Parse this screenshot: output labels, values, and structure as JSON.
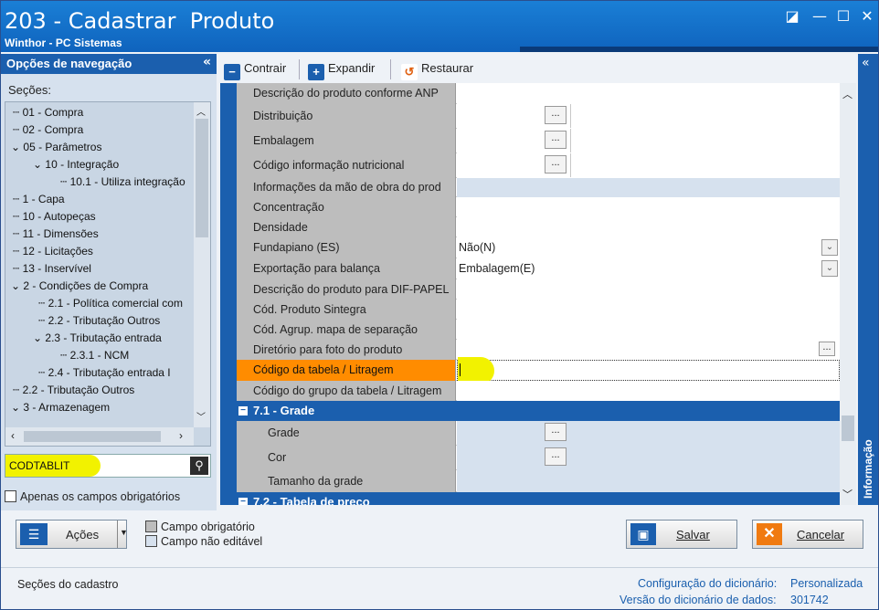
{
  "window": {
    "title": "203 - Cadastrar  Produto",
    "subtitle": "Winthor - PC Sistemas",
    "controls": [
      "◪",
      "—",
      "☐",
      "✕"
    ]
  },
  "nav": {
    "header": "Opções de navegação",
    "sections_label": "Seções:",
    "items": [
      "01 - Compra",
      "02 - Compra",
      "05 - Parâmetros",
      "10 - Integração",
      "10.1 - Utiliza integração",
      "1 - Capa",
      "10 - Autopeças",
      "11 - Dimensões",
      "12 - Licitações",
      "13 - Inservível",
      "2 - Condições de Compra",
      "2.1 - Política comercial com",
      "2.2 - Tributação Outros",
      "2.3 - Tributação entrada",
      "2.3.1 - NCM",
      "2.4 - Tributação entrada I",
      "2.2 - Tributação Outros",
      "3 - Armazenagem"
    ],
    "search_value": "CODTABLIT",
    "only_required": "Apenas os campos obrigatórios"
  },
  "toolbar": {
    "contrair": "Contrair",
    "expandir": "Expandir",
    "restaurar": "Restaurar"
  },
  "rows": [
    {
      "label": "Descrição do produto conforme ANP",
      "value": ""
    },
    {
      "label": "Distribuição",
      "value": ""
    },
    {
      "label": "Embalagem",
      "value": ""
    },
    {
      "label": "Código informação nutricional",
      "value": ""
    },
    {
      "label": "Informações da mão de obra do prod",
      "value": ""
    },
    {
      "label": "Concentração",
      "value": ""
    },
    {
      "label": "Densidade",
      "value": ""
    },
    {
      "label": "Fundapiano (ES)",
      "value": "Não(N)"
    },
    {
      "label": "Exportação para balança",
      "value": "Embalagem(E)"
    },
    {
      "label": "Descrição do produto para DIF-PAPEL",
      "value": ""
    },
    {
      "label": "Cód. Produto Sintegra",
      "value": ""
    },
    {
      "label": "Cód. Agrup. mapa de separação",
      "value": ""
    },
    {
      "label": "Diretório para foto do produto",
      "value": ""
    },
    {
      "label": "Código da tabela / Litragem",
      "value": ""
    },
    {
      "label": "Código do grupo da tabela / Litragem",
      "value": ""
    }
  ],
  "group_grade": {
    "title": "7.1 - Grade",
    "rows": [
      {
        "label": "Grade"
      },
      {
        "label": "Cor"
      },
      {
        "label": "Tamanho da grade"
      }
    ]
  },
  "group_preco": {
    "title": "7.2 - Tabela de preço"
  },
  "info_tab": "Informação",
  "bottom": {
    "acoes": "Ações",
    "legend_required": "Campo obrigatório",
    "legend_noedit": "Campo não editável",
    "salvar": "Salvar",
    "cancelar": "Cancelar"
  },
  "status": {
    "left": "Seções do cadastro",
    "config_label": "Configuração do dicionário:",
    "config_value": "Personalizada",
    "version_label": "Versão do dicionário de dados:",
    "version_value": "301742"
  },
  "colors": {
    "brand": "#1b5fae",
    "highlight_orange": "#ff8c00",
    "highlight_yellow": "#f2f200"
  }
}
